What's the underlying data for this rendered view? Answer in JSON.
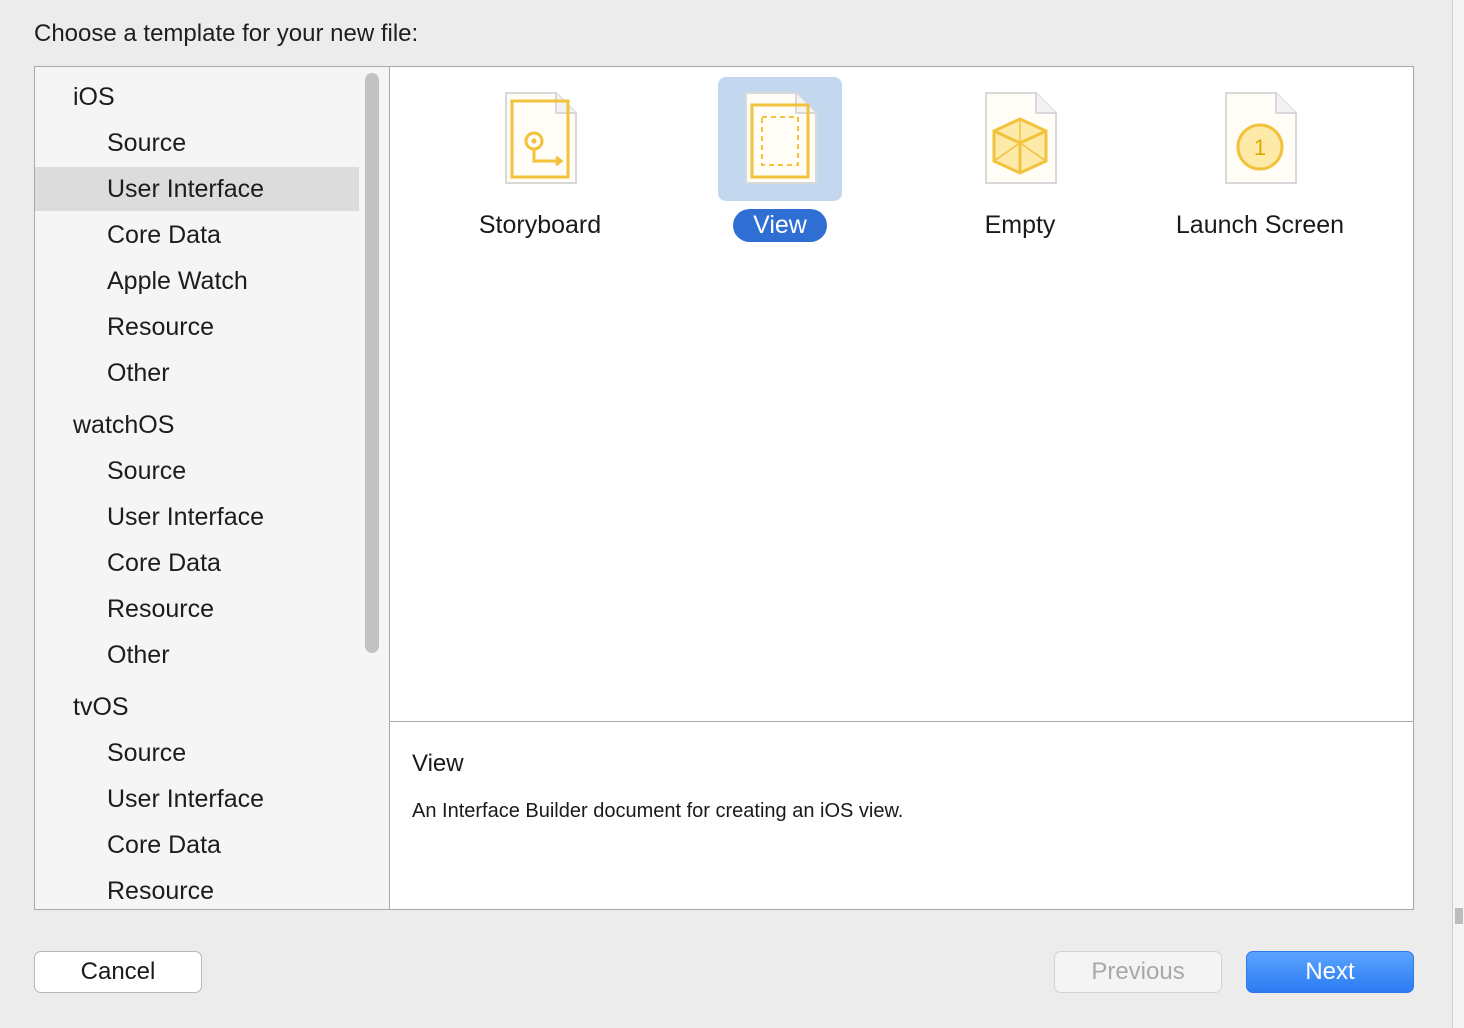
{
  "dialog": {
    "title": "Choose a template for your new file:"
  },
  "sidebar": {
    "rows": [
      {
        "label": "iOS",
        "kind": "header"
      },
      {
        "label": "Source",
        "kind": "item"
      },
      {
        "label": "User Interface",
        "kind": "item",
        "selected": true
      },
      {
        "label": "Core Data",
        "kind": "item"
      },
      {
        "label": "Apple Watch",
        "kind": "item"
      },
      {
        "label": "Resource",
        "kind": "item"
      },
      {
        "label": "Other",
        "kind": "item"
      },
      {
        "label": "watchOS",
        "kind": "header"
      },
      {
        "label": "Source",
        "kind": "item"
      },
      {
        "label": "User Interface",
        "kind": "item"
      },
      {
        "label": "Core Data",
        "kind": "item"
      },
      {
        "label": "Resource",
        "kind": "item"
      },
      {
        "label": "Other",
        "kind": "item"
      },
      {
        "label": "tvOS",
        "kind": "header"
      },
      {
        "label": "Source",
        "kind": "item"
      },
      {
        "label": "User Interface",
        "kind": "item"
      },
      {
        "label": "Core Data",
        "kind": "item"
      },
      {
        "label": "Resource",
        "kind": "item"
      }
    ]
  },
  "templates": [
    {
      "label": "Storyboard",
      "icon": "storyboard-icon",
      "selected": false
    },
    {
      "label": "View",
      "icon": "view-icon",
      "selected": true
    },
    {
      "label": "Empty",
      "icon": "empty-cube-icon",
      "selected": false
    },
    {
      "label": "Launch Screen",
      "icon": "launch-screen-icon",
      "selected": false
    }
  ],
  "description": {
    "name": "View",
    "text": "An Interface Builder document for creating an iOS view."
  },
  "buttons": {
    "cancel": "Cancel",
    "previous": "Previous",
    "next": "Next"
  },
  "colors": {
    "accent": "#2f6fd4",
    "icon_yellow": "#f2c23c",
    "selection_bg": "#c3d7ef"
  }
}
